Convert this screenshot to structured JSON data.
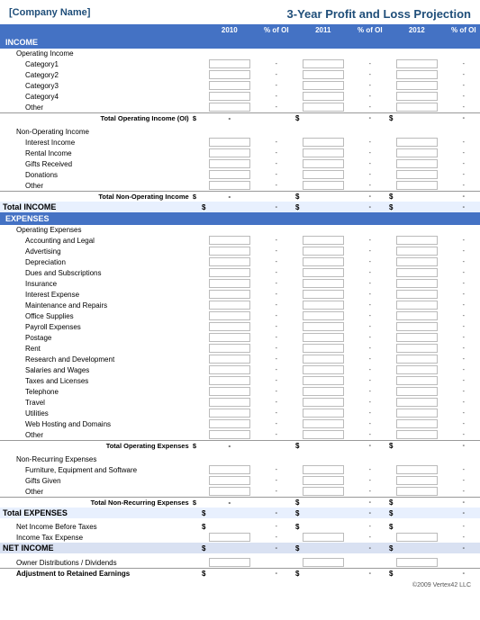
{
  "header": {
    "company_name": "[Company Name]",
    "report_title": "3-Year Profit and Loss Projection"
  },
  "columns": {
    "years": [
      "2010",
      "2011",
      "2012"
    ],
    "pct_label": "% of OI"
  },
  "income": {
    "section_label": "INCOME",
    "operating_income": {
      "label": "Operating Income",
      "items": [
        "Category1",
        "Category2",
        "Category3",
        "Category4",
        "Other"
      ],
      "total_label": "Total Operating Income (OI)"
    },
    "non_operating": {
      "label": "Non-Operating Income",
      "items": [
        "Interest Income",
        "Rental Income",
        "Gifts Received",
        "Donations",
        "Other"
      ],
      "total_label": "Total Non-Operating Income"
    },
    "total_label": "Total INCOME"
  },
  "expenses": {
    "section_label": "EXPENSES",
    "operating_expenses": {
      "label": "Operating Expenses",
      "items": [
        "Accounting and Legal",
        "Advertising",
        "Depreciation",
        "Dues and Subscriptions",
        "Insurance",
        "Interest Expense",
        "Maintenance and Repairs",
        "Office Supplies",
        "Payroll Expenses",
        "Postage",
        "Rent",
        "Research and Development",
        "Salaries and Wages",
        "Taxes and Licenses",
        "Telephone",
        "Travel",
        "Utilities",
        "Web Hosting and Domains",
        "Other"
      ],
      "total_label": "Total Operating Expenses"
    },
    "non_recurring": {
      "label": "Non-Recurring Expenses",
      "items": [
        "Furniture, Equipment and Software",
        "Gifts Given",
        "Other"
      ],
      "total_label": "Total Non-Recurring Expenses"
    },
    "total_label": "Total EXPENSES"
  },
  "net": {
    "before_taxes_label": "Net Income Before Taxes",
    "tax_label": "Income Tax Expense",
    "net_income_label": "NET INCOME",
    "distributions_label": "Owner Distributions / Dividends",
    "retained_label": "Adjustment to Retained Earnings"
  },
  "footer": {
    "copyright": "©2009 Vertex42 LLC"
  }
}
